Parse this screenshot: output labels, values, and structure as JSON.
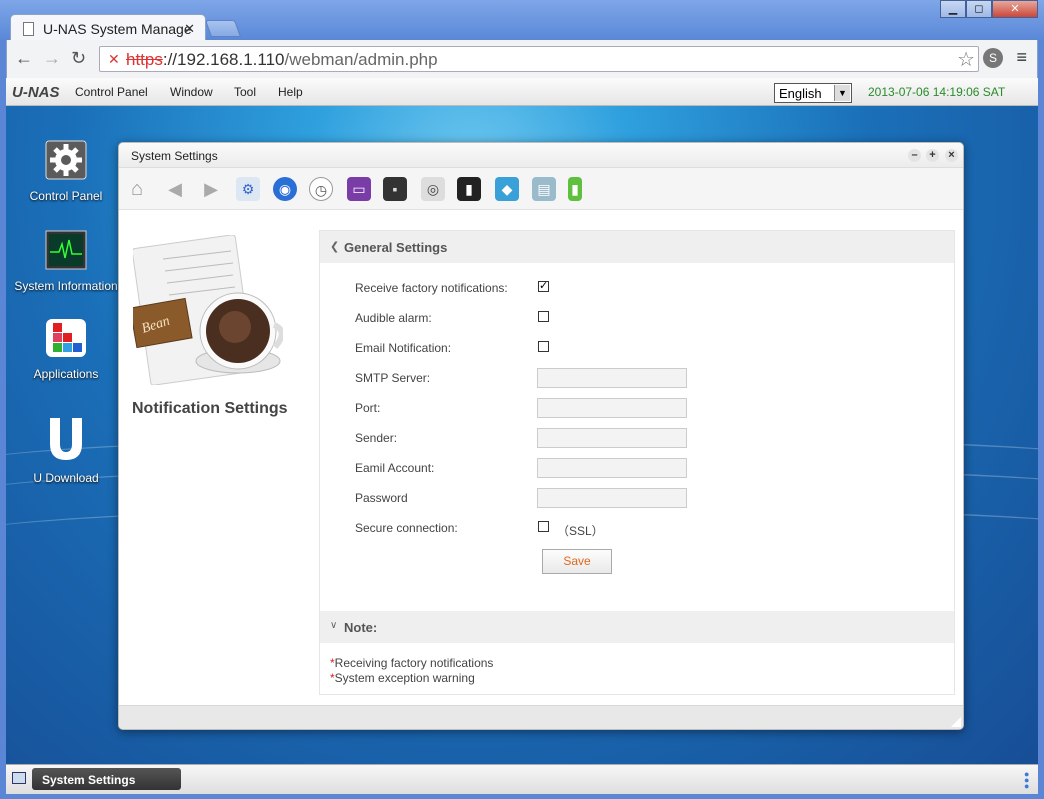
{
  "browser": {
    "tab_title": "U-NAS System Manage",
    "url_scheme": "https",
    "url_host": "://192.168.1.110",
    "url_path": "/webman/admin.php"
  },
  "menubar": {
    "brand": "U-NAS",
    "items": [
      "Control Panel",
      "Window",
      "Tool",
      "Help"
    ],
    "language": "English",
    "datetime": "2013-07-06 14:19:06 SAT"
  },
  "desktop": {
    "icons": [
      {
        "label": "Control Panel"
      },
      {
        "label": "System Information"
      },
      {
        "label": "Applications"
      },
      {
        "label": "U Download"
      }
    ]
  },
  "window": {
    "title": "System Settings",
    "side_title": "Notification Settings",
    "section_title": "General Settings",
    "fields": {
      "factory_label": "Receive factory notifications:",
      "factory_checked": true,
      "alarm_label": "Audible alarm:",
      "alarm_checked": false,
      "email_label": "Email Notification:",
      "email_checked": false,
      "smtp_label": "SMTP Server:",
      "smtp_value": "",
      "port_label": "Port:",
      "port_value": "",
      "sender_label": "Sender:",
      "sender_value": "",
      "account_label": "Eamil Account:",
      "account_value": "",
      "password_label": "Password",
      "password_value": "",
      "secure_label": "Secure connection:",
      "secure_checked": false,
      "ssl_label": "（SSL）"
    },
    "save_label": "Save",
    "note_title": "Note:",
    "notes": [
      "Receiving factory notifications",
      "System exception warning"
    ],
    "note_marker": "*"
  },
  "taskbar": {
    "active_task": "System Settings"
  },
  "colors": {
    "accent_orange": "#e06a1a",
    "clock_green": "#2a8a2a",
    "note_red": "#e02020"
  }
}
